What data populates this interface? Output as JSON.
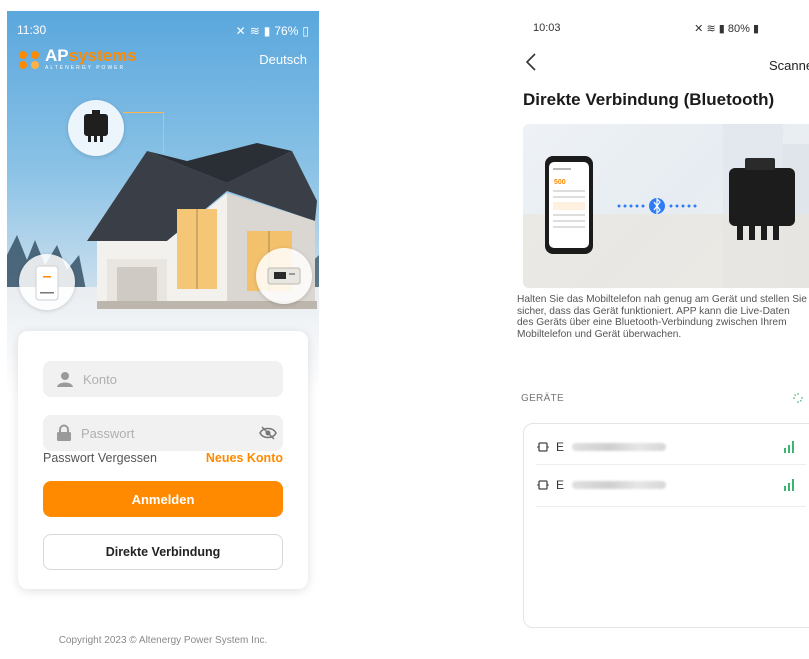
{
  "left": {
    "status": {
      "time": "11:30",
      "battery": "76%"
    },
    "logo": {
      "brand_ap": "AP",
      "brand_rest": "systems",
      "tagline": "ALTENERGY POWER"
    },
    "language": "Deutsch",
    "login": {
      "account_placeholder": "Konto",
      "password_placeholder": "Passwort",
      "forgot_label": "Passwort Vergessen",
      "new_account_label": "Neues Konto",
      "login_button": "Anmelden",
      "direct_button": "Direkte Verbindung"
    },
    "copyright": "Copyright 2023 © Altenergy Power System Inc.",
    "colors": {
      "accent": "#ff8a00",
      "sky": "#5aa7dd"
    }
  },
  "right": {
    "status": {
      "time": "10:03",
      "battery": "80%"
    },
    "nav": {
      "scanner_label": "Scanner"
    },
    "title": "Direkte Verbindung (Bluetooth)",
    "description": "Halten Sie das Mobiltelefon nah genug am Gerät und stellen Sie sicher, dass das Gerät funktioniert. APP kann die Live-Daten des Geräts über eine Bluetooth-Verbindung zwischen Ihrem Mobiltelefon und Gerät überwachen.",
    "devices_label": "GERÄTE",
    "devices": [
      {
        "name": "E"
      },
      {
        "name": "E"
      }
    ],
    "phone_mock": {
      "value": "500"
    },
    "colors": {
      "bluetooth": "#2f7bf5",
      "signal": "#3cb371"
    }
  }
}
